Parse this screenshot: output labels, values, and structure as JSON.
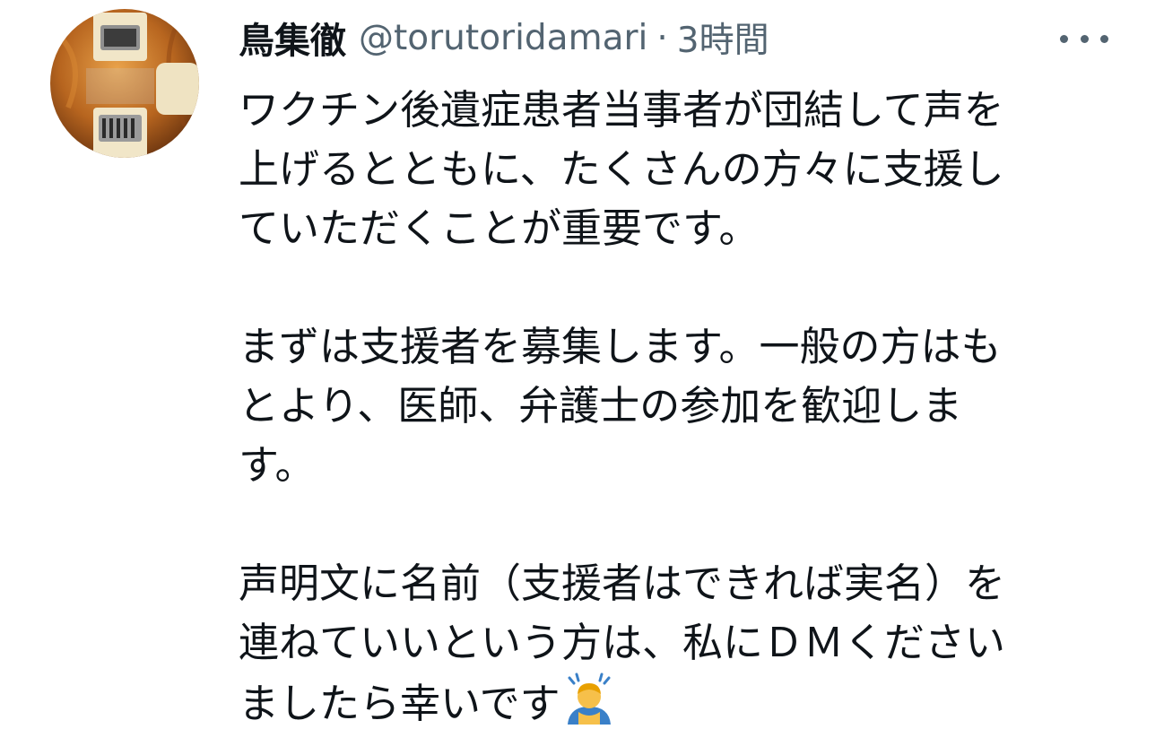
{
  "tweet": {
    "display_name": "鳥集徹",
    "handle": "@torutoridamari",
    "separator": "·",
    "time": "3時間",
    "paragraphs": [
      [
        "ワクチン後遺症患者当事者が団結して声を",
        "上げるとともに、たくさんの方々に支援し",
        "ていただくことが重要です。"
      ],
      [
        "まずは支援者を募集します。一般の方はも",
        "とより、医師、弁護士の参加を歓迎しま",
        "す。"
      ],
      [
        "声明文に名前（支援者はできれば実名）を",
        "連ねていいという方は、私にＤＭください",
        "ましたら幸いです"
      ]
    ],
    "trailing_emoji": "person-bowing-emoji"
  },
  "icons": {
    "more": "more-horizontal-icon",
    "avatar": "guitar-avatar"
  },
  "colors": {
    "text": "#0f1419",
    "secondary": "#536471",
    "avatar_wood": "#b7651f",
    "emoji_skin": "#f6c04a",
    "emoji_shirt": "#3a80c8"
  }
}
